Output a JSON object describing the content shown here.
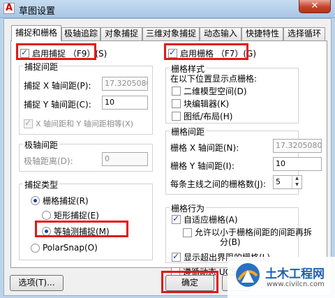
{
  "window": {
    "title": "草图设置",
    "app_icon": "A",
    "close_glyph": "✕"
  },
  "tabs": [
    "捕捉和栅格",
    "极轴追踪",
    "对象捕捉",
    "三维对象捕捉",
    "动态输入",
    "快捷特性",
    "选择循环"
  ],
  "snap": {
    "enable_label": "启用捕捉 （F9）(S)",
    "enable_checked": true,
    "spacing_title": "捕捉间距",
    "x_label": "捕捉 X 轴间距(P):",
    "x_value": "17.3205080",
    "y_label": "捕捉 Y 轴间距(C):",
    "y_value": "10",
    "equal_label": "X 轴间距和 Y 轴间距相等(X)",
    "equal_checked": true
  },
  "polar": {
    "title": "极轴间距",
    "distance_label": "极轴距离(D):",
    "distance_value": "0"
  },
  "snap_type": {
    "title": "捕捉类型",
    "grid_snap": "栅格捕捉(R)",
    "rect_snap": "矩形捕捉(E)",
    "iso_snap": "等轴测捕捉(M)",
    "polar_snap": "PolarSnap(O)"
  },
  "grid": {
    "enable_label": "启用栅格 （F7）(G)",
    "enable_checked": true,
    "style_title": "栅格样式",
    "style_desc": "在以下位置显示点栅格:",
    "model_2d": "二维模型空间(D)",
    "block_editor": "块编辑器(K)",
    "layout": "图纸/布局(H)",
    "spacing_title": "栅格间距",
    "x_label": "栅格 X 轴间距(N):",
    "x_value": "17.3205080",
    "y_label": "栅格 Y 轴间距(I):",
    "y_value": "10",
    "major_label": "每条主线之间的栅格数(J):",
    "major_value": "5",
    "behavior_title": "栅格行为",
    "adaptive": "自适应栅格(A)",
    "subdivide_line1": "允许以小于栅格间距的间距再拆",
    "subdivide_line2": "分(B)",
    "beyond_limits": "显示超出界限的栅格(L)",
    "follow_ucs": "遵循动态 UCS(U)"
  },
  "buttons": {
    "options": "选项(T)...",
    "ok": "确定"
  },
  "watermark": {
    "title": "土木工程网",
    "url": "www.civilcn.com"
  },
  "colors": {
    "highlight": "#e21818",
    "titlebar": "#bcd3ea",
    "close": "#c5432b"
  }
}
